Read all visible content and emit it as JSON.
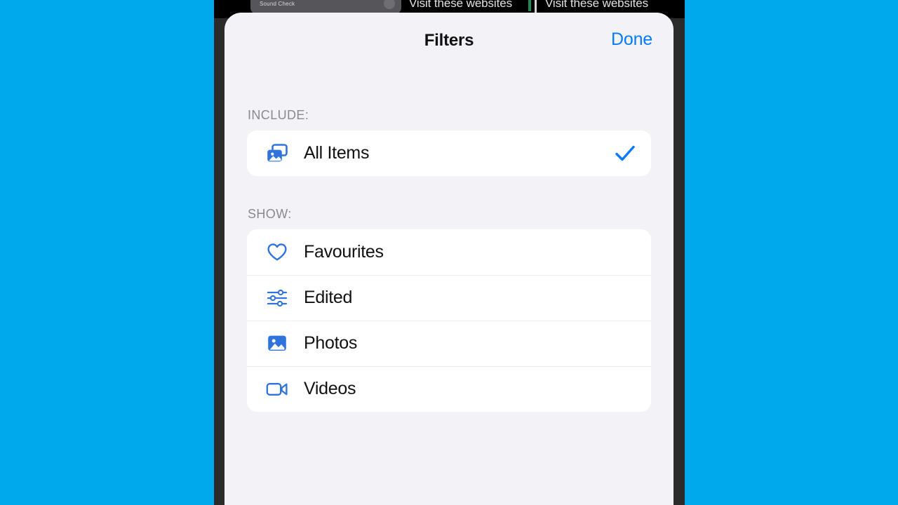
{
  "background": {
    "sound_check_label": "Sound Check",
    "websites_label_1": "Visit these websites",
    "websites_label_2": "Visit these websites"
  },
  "sheet": {
    "title": "Filters",
    "done_label": "Done",
    "accent_color": "#067BFC",
    "sheet_background": "#f2f2f7",
    "card_background": "#ffffff",
    "page_background": "#00A8EC",
    "bezel_color": "#2b2b2b",
    "sections": [
      {
        "header": "INCLUDE:",
        "items": [
          {
            "label": "All Items",
            "icon": "stacked-photos-icon",
            "checked": true
          }
        ]
      },
      {
        "header": "SHOW:",
        "items": [
          {
            "label": "Favourites",
            "icon": "heart-icon",
            "checked": false
          },
          {
            "label": "Edited",
            "icon": "sliders-icon",
            "checked": false
          },
          {
            "label": "Photos",
            "icon": "photo-icon",
            "checked": false
          },
          {
            "label": "Videos",
            "icon": "video-camera-icon",
            "checked": false
          }
        ]
      }
    ]
  }
}
